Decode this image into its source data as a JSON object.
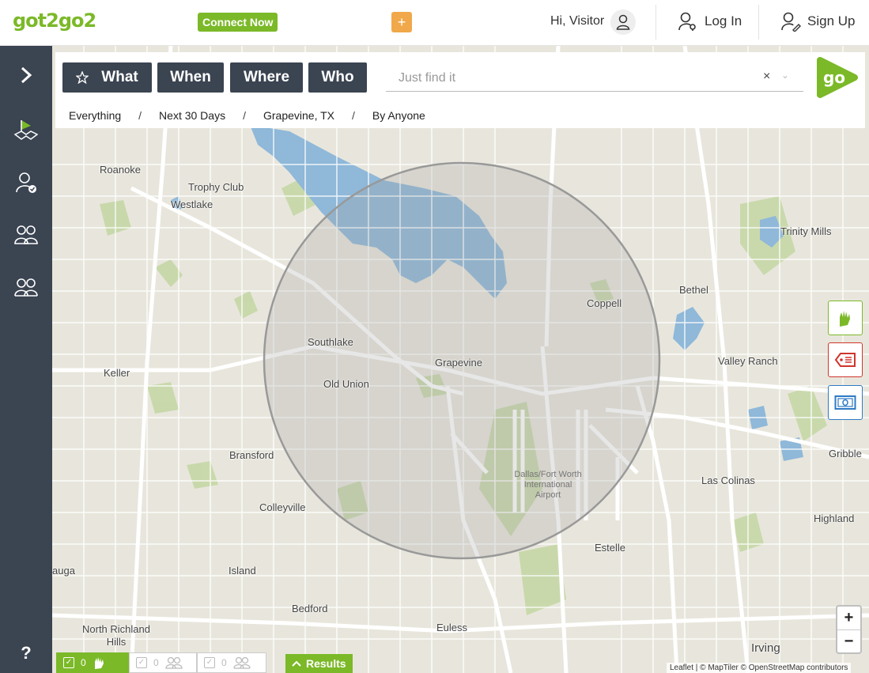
{
  "header": {
    "logo_text": "got2go2",
    "connect_label": "Connect Now",
    "add_label": "+",
    "greeting": "Hi, Visitor",
    "login_label": "Log In",
    "signup_label": "Sign Up"
  },
  "sidebar": {
    "items": [
      {
        "icon": "chevron-right-icon"
      },
      {
        "icon": "map-flag-icon"
      },
      {
        "icon": "user-check-icon"
      },
      {
        "icon": "users-icon"
      },
      {
        "icon": "group-icon"
      }
    ],
    "help_label": "?"
  },
  "search": {
    "tabs": [
      "What",
      "When",
      "Where",
      "Who"
    ],
    "placeholder": "Just find it",
    "clear_label": "×",
    "go_label": "go",
    "crumbs": [
      "Everything",
      "Next 30 Days",
      "Grapevine, TX",
      "By Anyone"
    ],
    "crumb_sep": "/"
  },
  "map": {
    "labels": [
      "Roanoke",
      "Trophy Club",
      "Westlake",
      "Trinity Mills",
      "Bethel",
      "Coppell",
      "Southlake",
      "Grapevine",
      "Old Union",
      "Keller",
      "Valley Ranch",
      "Bransford",
      "Colleyville",
      "Las Colinas",
      "Gribble",
      "Highland",
      "Estelle",
      "Island",
      "Bedford",
      "Euless",
      "North Richland Hills",
      "Irving",
      "auga"
    ],
    "airport": [
      "Dallas/Fort Worth",
      "International",
      "Airport"
    ],
    "zoom_in": "+",
    "zoom_out": "−",
    "attribution": "Leaflet | © MapTiler © OpenStreetMap contributors",
    "colors": {
      "land": "#e8e6dc",
      "water": "#8fb8d9",
      "park": "#c5d7a6",
      "road": "#ffffff",
      "radius": "#999999",
      "accent": "#7bb928"
    }
  },
  "right_buttons": [
    {
      "icon": "hands-icon",
      "color": "#7bb928"
    },
    {
      "icon": "tag-icon",
      "color": "#d0342c"
    },
    {
      "icon": "money-icon",
      "color": "#2e7bc4"
    }
  ],
  "bottom": {
    "tabs": [
      {
        "count": "0",
        "icon": "hand-icon"
      },
      {
        "count": "0",
        "icon": "user-group-icon"
      },
      {
        "count": "0",
        "icon": "people-icon"
      }
    ],
    "results_label": "Results"
  }
}
